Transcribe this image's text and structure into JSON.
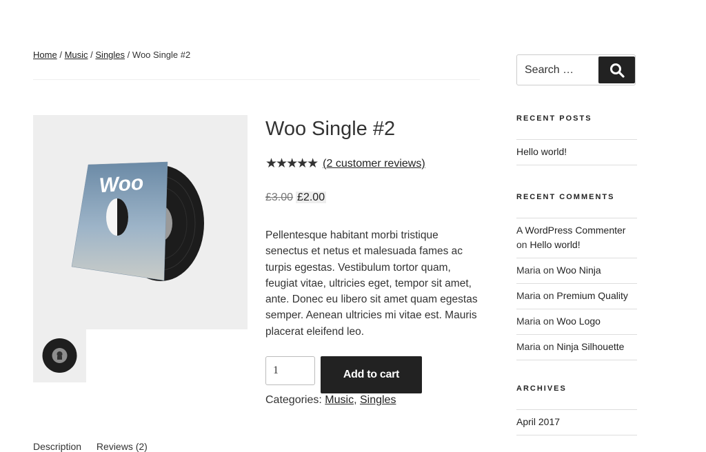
{
  "breadcrumb": {
    "items": [
      "Home",
      "Music",
      "Singles"
    ],
    "separator": "/",
    "current": "Woo Single #2"
  },
  "product": {
    "title": "Woo Single #2",
    "stars": "★★★★★",
    "rating": 4.5,
    "rating_max": 5,
    "reviews_link": "(2 customer reviews)",
    "price_old": "£3.00",
    "price_new": "£2.00",
    "description": "Pellentesque habitant morbi tristique senectus et netus et malesuada fames ac turpis egestas. Vestibulum tortor quam, feugiat vitae, ultricies eget, tempor sit amet, ante. Donec eu libero sit amet quam egestas semper. Aenean ultricies mi vitae est. Mauris placerat eleifend leo.",
    "quantity": "1",
    "add_to_cart": "Add to cart",
    "categories_label": "Categories:",
    "categories": [
      "Music",
      "Singles"
    ],
    "categories_sep": ",",
    "cover_text": "Woo",
    "image_icon": "vinyl-record-image",
    "thumbnail_icon": "vinyl-record-thumbnail"
  },
  "tabs": [
    "Description",
    "Reviews (2)"
  ],
  "sidebar": {
    "search": {
      "placeholder": "Search …",
      "icon": "search-icon"
    },
    "recent_posts": {
      "title": "Recent Posts",
      "items": [
        {
          "link": "Hello world!"
        }
      ]
    },
    "recent_comments": {
      "title": "Recent Comments",
      "items": [
        {
          "author": "A WordPress Commenter",
          "on": "on",
          "post": "Hello world!"
        },
        {
          "author": "Maria",
          "on": "on",
          "post": "Woo Ninja"
        },
        {
          "author": "Maria",
          "on": "on",
          "post": "Premium Quality"
        },
        {
          "author": "Maria",
          "on": "on",
          "post": "Woo Logo"
        },
        {
          "author": "Maria",
          "on": "on",
          "post": "Ninja Silhouette"
        }
      ]
    },
    "archives": {
      "title": "Archives",
      "items": [
        {
          "link": "April 2017"
        }
      ]
    }
  },
  "colors": {
    "button_bg": "#222222",
    "gallery_bg": "#eeeeee",
    "text": "#333333"
  }
}
